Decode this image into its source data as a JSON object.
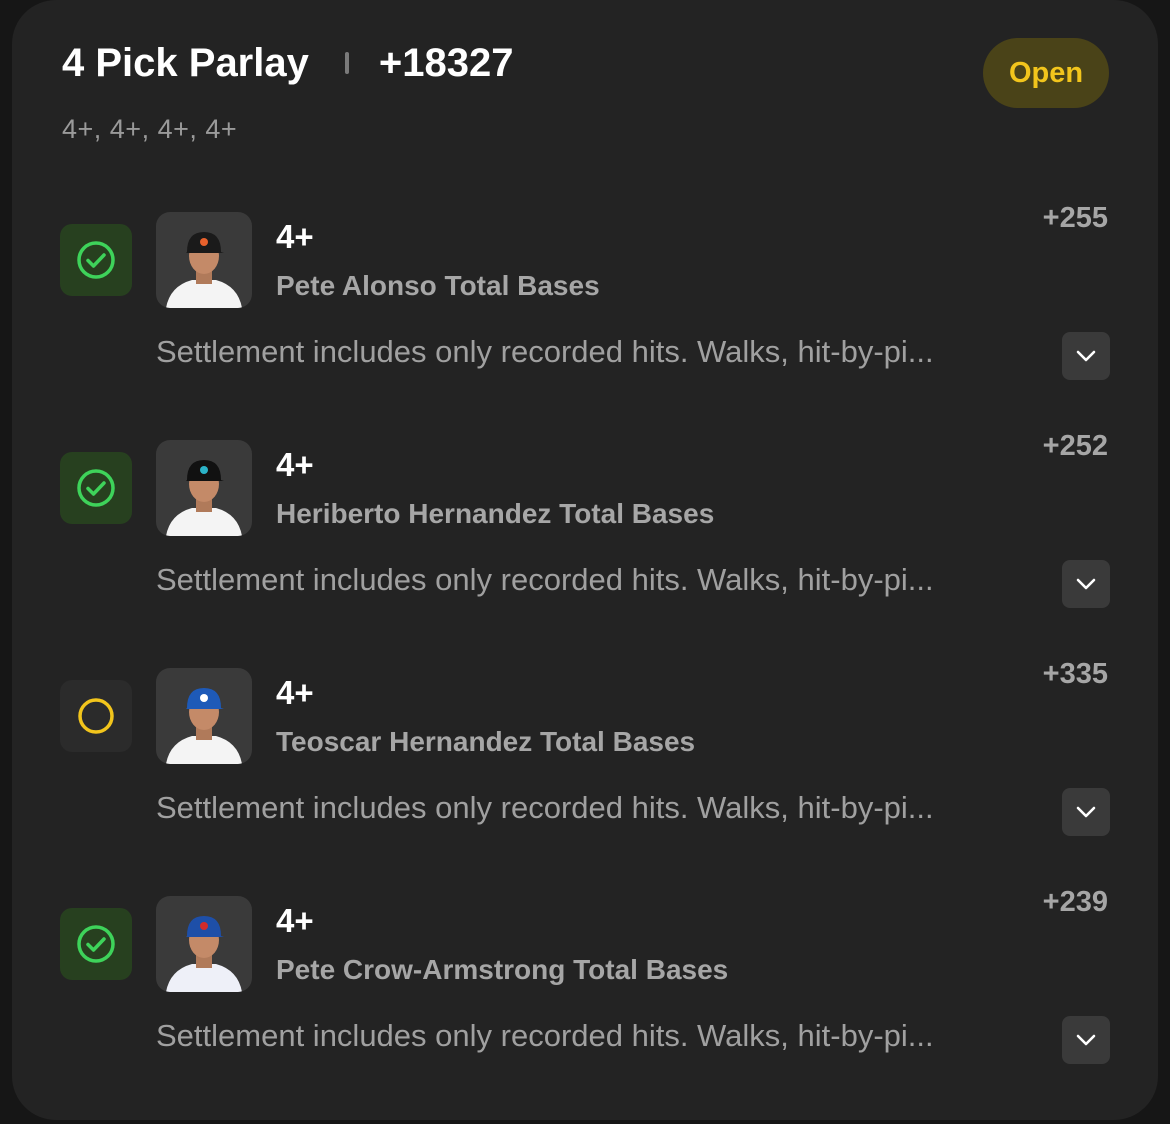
{
  "header": {
    "title": "4 Pick Parlay",
    "odds": "+18327",
    "status": "Open",
    "subtitle": "4+, 4+, 4+, 4+"
  },
  "colors": {
    "won": "#3ed35a",
    "pending": "#f2c51c"
  },
  "legs": [
    {
      "status": "won",
      "status_icon": "check-circle-icon",
      "line": "4+",
      "player_market": "Pete Alonso Total Bases",
      "odds": "+255",
      "settlement": "Settlement includes only recorded hits. Walks, hit-by-pi...",
      "cap_color": "#1a1a1a",
      "cap_accent": "#e8612c",
      "jersey_color": "#f4f4f4"
    },
    {
      "status": "won",
      "status_icon": "check-circle-icon",
      "line": "4+",
      "player_market": "Heriberto Hernandez Total Bases",
      "odds": "+252",
      "settlement": "Settlement includes only recorded hits. Walks, hit-by-pi...",
      "cap_color": "#111111",
      "cap_accent": "#2bb3c8",
      "jersey_color": "#f4f4f4"
    },
    {
      "status": "pending",
      "status_icon": "empty-circle-icon",
      "line": "4+",
      "player_market": "Teoscar Hernandez Total Bases",
      "odds": "+335",
      "settlement": "Settlement includes only recorded hits. Walks, hit-by-pi...",
      "cap_color": "#1e5ab8",
      "cap_accent": "#ffffff",
      "jersey_color": "#f4f4f4"
    },
    {
      "status": "won",
      "status_icon": "check-circle-icon",
      "line": "4+",
      "player_market": "Pete Crow-Armstrong Total Bases",
      "odds": "+239",
      "settlement": "Settlement includes only recorded hits. Walks, hit-by-pi...",
      "cap_color": "#1e4fa8",
      "cap_accent": "#d22b2b",
      "jersey_color": "#eef0f8"
    }
  ]
}
